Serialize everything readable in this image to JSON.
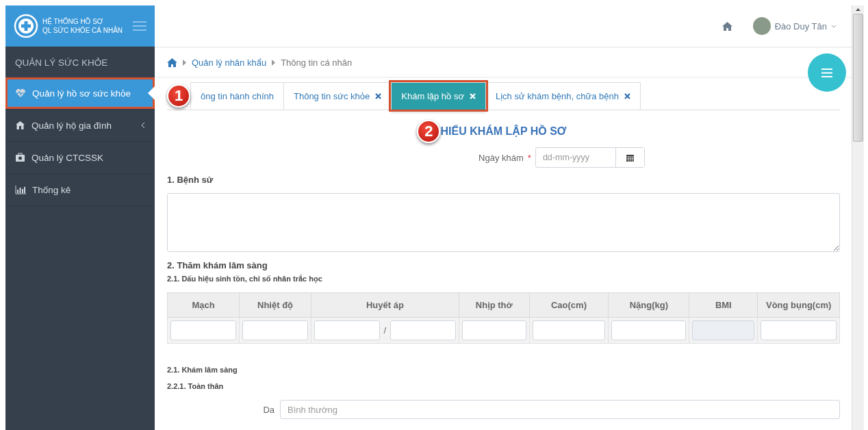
{
  "brand": {
    "line_1": "HỆ THỐNG HỒ SƠ",
    "line_2": "QL SỨC KHỎE CÁ NHÂN"
  },
  "header": {
    "user_name": "Đào Duy Tân"
  },
  "sidebar": {
    "section_title": "QUẢN LÝ SỨC KHỎE",
    "items": [
      {
        "label": "Quản lý hồ sơ sức khỏe",
        "selected": true,
        "highlighted": true,
        "has_children": false
      },
      {
        "label": "Quản lý hộ gia đình",
        "selected": false,
        "highlighted": false,
        "has_children": true
      },
      {
        "label": "Quản lý CTCSSK",
        "selected": false,
        "highlighted": false,
        "has_children": false
      },
      {
        "label": "Thống kê",
        "selected": false,
        "highlighted": false,
        "has_children": false
      }
    ]
  },
  "breadcrumb": [
    "Quản lý nhân khẩu",
    "Thông tin cá nhân"
  ],
  "tabs": [
    {
      "label": "ông tin hành chính",
      "selected": false,
      "closable": false,
      "highlighted": false,
      "callout": "1"
    },
    {
      "label": "Thông tin sức khỏe",
      "selected": false,
      "closable": true,
      "highlighted": false
    },
    {
      "label": "Khám lập hồ sơ",
      "selected": true,
      "closable": true,
      "highlighted": true
    },
    {
      "label": "Lịch sử khám bệnh, chữa bệnh",
      "selected": false,
      "closable": true,
      "highlighted": false
    }
  ],
  "form": {
    "title": "HIẾU KHÁM LẬP HỒ SƠ",
    "title_callout": "2",
    "date": {
      "label": "Ngày khám",
      "required_mark": "*",
      "placeholder": "dd-mm-yyyy"
    },
    "history_heading": "1. Bệnh sử",
    "clinical_heading": "2. Thăm khám lâm sàng",
    "vitals_heading": "2.1. Dấu hiệu sinh tồn, chỉ số nhân trắc học",
    "vitals_columns": [
      {
        "label": "Mạch",
        "kind": "text"
      },
      {
        "label": "Nhiệt độ",
        "kind": "text"
      },
      {
        "label": "Huyết áp",
        "kind": "pair",
        "separator": "/"
      },
      {
        "label": "Nhịp thở",
        "kind": "text"
      },
      {
        "label": "Cao(cm)",
        "kind": "text"
      },
      {
        "label": "Nặng(kg)",
        "kind": "text"
      },
      {
        "label": "BMI",
        "kind": "disabled"
      },
      {
        "label": "Vòng bụng(cm)",
        "kind": "text"
      }
    ],
    "exam_heading": "2.1. Khám lâm sàng",
    "general_heading": "2.2.1. Toàn thân",
    "general_fields": [
      {
        "label": "Da",
        "placeholder": "Bình thường"
      }
    ]
  }
}
